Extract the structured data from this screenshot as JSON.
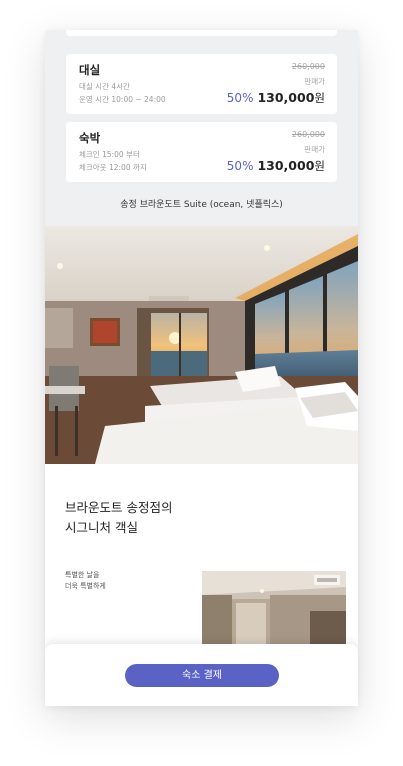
{
  "rates": [
    {
      "title": "대실",
      "line1": "대실 시간 4시간",
      "line2": "운영 시간  10:00 ~ 24:00",
      "original_price": "260,000",
      "sale_label": "판매가",
      "discount": "50%",
      "price": "130,000",
      "price_unit": "원"
    },
    {
      "title": "숙박",
      "line1": "체크인 15:00 부터",
      "line2": "체크아웃 12:00 까지",
      "original_price": "260,000",
      "sale_label": "판매가",
      "discount": "50%",
      "price": "130,000",
      "price_unit": "원"
    }
  ],
  "room_name": "송정 브라운도트 Suite (ocean, 넷플릭스)",
  "headline": {
    "line1": "브라운도트 송정점의",
    "line2": "시그니처 객실"
  },
  "subcopy": {
    "line1": "특별한 날을",
    "line2": "더욱 특별하게"
  },
  "pay_button": "숙소 결제",
  "colors": {
    "accent": "#5a63c5",
    "page_background": "#eef0f2",
    "card_background": "#ffffff"
  },
  "icons": []
}
